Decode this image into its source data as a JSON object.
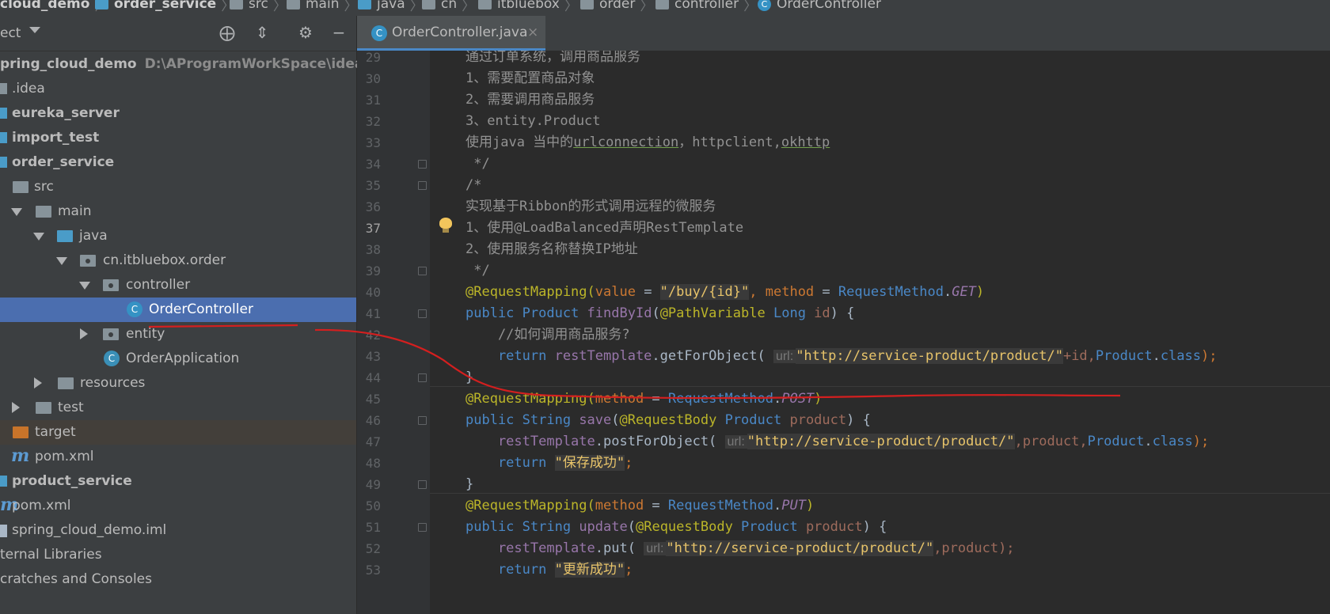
{
  "breadcrumb": [
    "cloud_demo",
    "order_service",
    "src",
    "main",
    "java",
    "cn",
    "itbluebox",
    "order",
    "controller",
    "OrderController"
  ],
  "panel": {
    "title": "ect"
  },
  "tree": [
    {
      "label": "pring_cloud_demo",
      "path": "D:\\AProgramWorkSpace\\idea\\test\\s"
    },
    {
      "label": ".idea"
    },
    {
      "label": "eureka_server"
    },
    {
      "label": "import_test"
    },
    {
      "label": "order_service"
    },
    {
      "label": "src"
    },
    {
      "label": "main"
    },
    {
      "label": "java"
    },
    {
      "label": "cn.itbluebox.order"
    },
    {
      "label": "controller"
    },
    {
      "label": "OrderController"
    },
    {
      "label": "entity"
    },
    {
      "label": "OrderApplication"
    },
    {
      "label": "resources"
    },
    {
      "label": "test"
    },
    {
      "label": "target"
    },
    {
      "label": "pom.xml"
    },
    {
      "label": "product_service"
    },
    {
      "label": "pom.xml"
    },
    {
      "label": "spring_cloud_demo.iml"
    },
    {
      "label": "ternal Libraries"
    },
    {
      "label": "cratches and Consoles"
    }
  ],
  "tab": {
    "label": "OrderController.java",
    "close": "×"
  },
  "editor": {
    "line_numbers": [
      "29",
      "30",
      "31",
      "32",
      "33",
      "34",
      "35",
      "36",
      "37",
      "38",
      "39",
      "40",
      "41",
      "42",
      "43",
      "44",
      "45",
      "46",
      "47",
      "48",
      "49",
      "50",
      "51",
      "52",
      "53"
    ],
    "hint_url": "url:",
    "lines": {
      "l29": "通过订单系统，调用商品服务",
      "l30": "1、需要配置商品对象",
      "l31": "2、需要调用商品服务",
      "l32": "3、entity.Product",
      "l33a": "使用java 当中的",
      "l33b": "urlconnection",
      "l33c": "，httpclient,",
      "l33d": "okhttp",
      "l34": " */",
      "l35": "/*",
      "l36": "实现基于Ribbon的形式调用远程的微服务",
      "l37": "1、使用@LoadBalanced声明RestTemplate",
      "l38": "2、使用服务名称替换IP地址",
      "l39": " */",
      "l40_ann": "@RequestMapping(",
      "l40_k1": "value",
      "l40_eq": " = ",
      "l40_str": "\"/buy/{id}\"",
      "l40_c": ", ",
      "l40_k2": "method",
      "l40_eq2": " = ",
      "l40_type": "RequestMethod",
      "l40_dot": ".",
      "l40_const": "GET",
      "l40_end": ")",
      "l41_pub": "public ",
      "l41_type": "Product ",
      "l41_fn": "findById",
      "l41_p": "(",
      "l41_ann": "@PathVariable ",
      "l41_long": "Long ",
      "l41_id": "id",
      "l41_end": ") {",
      "l42": "    //如何调用商品服务?",
      "l43_ret": "    return ",
      "l43_rt": "restTemplate",
      "l43_call": ".getForObject( ",
      "l43_str": "\"http://service-product/product/\"",
      "l43_rest1": "+id,",
      "l43_prod": "Product",
      "l43_dot": ".",
      "l43_cls": "class",
      "l43_end": ");",
      "l44": "}",
      "l45_ann": "@RequestMapping(",
      "l45_k": "method",
      "l45_eq": " = ",
      "l45_type": "RequestMethod",
      "l45_dot": ".",
      "l45_const": "POST",
      "l45_end": ")",
      "l46_pub": "public ",
      "l46_type": "String ",
      "l46_fn": "save",
      "l46_p": "(",
      "l46_ann": "@RequestBody ",
      "l46_ptype": "Product ",
      "l46_pname": "product",
      "l46_end": ") {",
      "l47_rt": "    restTemplate",
      "l47_call": ".postForObject( ",
      "l47_str": "\"http://service-product/product/\"",
      "l47_rest": ",product,",
      "l47_prod": "Product",
      "l47_dot": ".",
      "l47_cls": "class",
      "l47_end": ");",
      "l48_ret": "    return ",
      "l48_str": "\"保存成功\"",
      "l48_end": ";",
      "l49": "}",
      "l50_ann": "@RequestMapping(",
      "l50_k": "method",
      "l50_eq": " = ",
      "l50_type": "RequestMethod",
      "l50_dot": ".",
      "l50_const": "PUT",
      "l50_end": ")",
      "l51_pub": "public ",
      "l51_type": "String ",
      "l51_fn": "update",
      "l51_p": "(",
      "l51_ann": "@RequestBody ",
      "l51_ptype": "Product ",
      "l51_pname": "product",
      "l51_end": ") {",
      "l52_rt": "    restTemplate",
      "l52_call": ".put( ",
      "l52_str": "\"http://service-product/product/\"",
      "l52_rest": ",product);",
      "l53_ret": "    return ",
      "l53_str": "\"更新成功\"",
      "l53_end": ";"
    }
  },
  "colors": {
    "selection": "#4b6eaf",
    "editor_bg": "#2b2b2b",
    "panel_bg": "#3c3f41",
    "annotation_ink": "#d41f1f"
  }
}
